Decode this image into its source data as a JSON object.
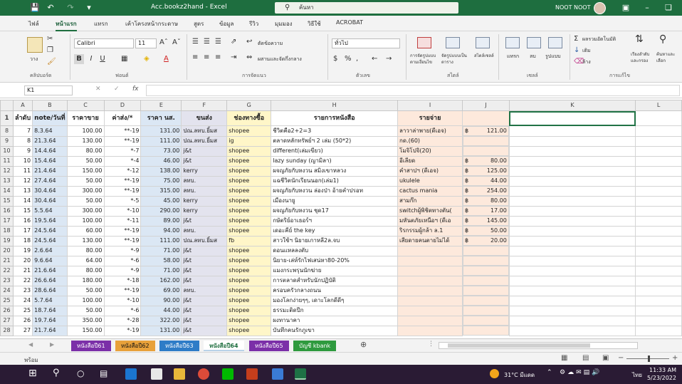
{
  "title_bar": {
    "filename": "Acc.bookz2hand - Excel",
    "search_placeholder": "ค้นหา",
    "user": "NOOT NOOT"
  },
  "ribbon_tabs": [
    "ไฟล์",
    "หน้าแรก",
    "แทรก",
    "เค้าโครงหน้ากระดาษ",
    "สูตร",
    "ข้อมูล",
    "รีวิว",
    "มุมมอง",
    "วิธีใช้",
    "ACROBAT"
  ],
  "ribbon": {
    "paste_label": "วาง",
    "font_name": "Calibri",
    "font_size": "11",
    "wrap_text": "ตัดข้อความ",
    "merge_center": "ผสานและจัดกึ่งกลาง",
    "number_format": "ทั่วไป",
    "cond_format": "การจัดรูปแบบตามเงื่อนไข",
    "format_table": "จัดรูปแบบเป็นตาราง",
    "cell_styles": "สไตล์เซลล์",
    "insert": "แทรก",
    "delete": "ลบ",
    "format": "รูปแบบ",
    "autosum": "ผลรวมอัตโนมัติ",
    "fill": "เติม",
    "clear": "ล้าง",
    "sort_filter": "เรียงลำดับและกรอง",
    "find_select": "ค้นหาและเลือก",
    "groups": [
      "คลิปบอร์ด",
      "ฟอนต์",
      "การจัดแนว",
      "ตัวเลข",
      "สไตล์",
      "เซลล์",
      "การแก้ไข"
    ]
  },
  "formula_bar": {
    "name_box": "K1",
    "fx": "fx",
    "content": ""
  },
  "columns": [
    "A",
    "B",
    "C",
    "D",
    "E",
    "F",
    "G",
    "H",
    "I",
    "J",
    "K",
    "L"
  ],
  "header_row": {
    "row": "1",
    "cells": [
      "ลำดับ",
      "note/วันที่",
      "ราคาขาย",
      "ค่าส่ง/*",
      "ราคา นส.",
      "ขนส่ง",
      "ช่องทางซื้อ",
      "รายการหนังสือ",
      "รายจ่าย",
      "",
      "",
      ""
    ]
  },
  "rows": [
    {
      "r": "8",
      "a": "7",
      "b": "8.3.64",
      "c": "100.00",
      "d": "**-19",
      "e": "131.00",
      "f": "ปณ.ลทบ.ยิ้มส",
      "g": "shopee",
      "h": "ชีวิตคือ2+2=3",
      "i": "ลาวาล่าพาย(ดีเอจ)",
      "cur": "฿",
      "j": "121.00"
    },
    {
      "r": "9",
      "a": "8",
      "b": "21.3.64",
      "c": "130.00",
      "d": "**-19",
      "e": "111.00",
      "f": "ปณ.ลทบ.ยิ้มส",
      "g": "ig",
      "h": "ตลาดหลักทรัพย์ฯ 2 เล่ม (50*2)",
      "i": "กด.(60)",
      "cur": "",
      "j": ""
    },
    {
      "r": "10",
      "a": "9",
      "b": "14.4.64",
      "c": "80.00",
      "d": "*-7",
      "e": "73.00",
      "f": "j&t",
      "g": "shopee",
      "h": "different(เล่มเขียว)",
      "i": "โมจิโปจิ(20)",
      "cur": "",
      "j": ""
    },
    {
      "r": "11",
      "a": "10",
      "b": "15.4.64",
      "c": "50.00",
      "d": "*-4",
      "e": "46.00",
      "f": "j&t",
      "g": "shopee",
      "h": "lazy sunday (ญามิลา)",
      "i": "อีเลียด",
      "cur": "฿",
      "j": "80.00"
    },
    {
      "r": "12",
      "a": "11",
      "b": "21.4.64",
      "c": "150.00",
      "d": "*-12",
      "e": "138.00",
      "f": "kerry",
      "g": "shopee",
      "h": "ผจญภัยกับหงวน สมิงเขาหลวง",
      "i": "คำสาปฯ (ดีเอจ)",
      "cur": "฿",
      "j": "125.00"
    },
    {
      "r": "13",
      "a": "12",
      "b": "27.4.64",
      "c": "50.00",
      "d": "**-19",
      "e": "75.00",
      "f": "ลทบ.",
      "g": "shopee",
      "h": "แฉชีวิตนักเรียนนอก(เล่ม1)",
      "i": "ukulele",
      "cur": "฿",
      "j": "44.00"
    },
    {
      "r": "14",
      "a": "13",
      "b": "30.4.64",
      "c": "300.00",
      "d": "**-19",
      "e": "315.00",
      "f": "ลทบ.",
      "g": "shopee",
      "h": "ผจญภัยกับหงวน ล่องป่า อ้ายคำปรอท",
      "i": "cactus mania",
      "cur": "฿",
      "j": "254.00"
    },
    {
      "r": "15",
      "a": "14",
      "b": "30.4.64",
      "c": "50.00",
      "d": "*-5",
      "e": "45.00",
      "f": "kerry",
      "g": "shopee",
      "h": "เมืองนายู",
      "i": "สามก๊ก",
      "cur": "฿",
      "j": "80.00"
    },
    {
      "r": "16",
      "a": "15",
      "b": "5.5.64",
      "c": "300.00",
      "d": "*-10",
      "e": "290.00",
      "f": "kerry",
      "g": "shopee",
      "h": "ผจญภัยกับหงวน ชุด17",
      "i": "switchผู้พิชิตทางตัน(",
      "cur": "฿",
      "j": "17.00"
    },
    {
      "r": "17",
      "a": "16",
      "b": "19.5.64",
      "c": "100.00",
      "d": "*-11",
      "e": "89.00",
      "f": "j&t",
      "g": "shopee",
      "h": "กษัตริย์อาเธอร์ฯ",
      "i": "มหันตภัยเหนือฯ (ดีเอ",
      "cur": "฿",
      "j": "145.00"
    },
    {
      "r": "18",
      "a": "17",
      "b": "24.5.64",
      "c": "60.00",
      "d": "**-19",
      "e": "94.00",
      "f": "ลทบ.",
      "g": "shopee",
      "h": "เดอะคีย์ the key",
      "i": "ริรกรรมผู้กล้า ล.1",
      "cur": "฿",
      "j": "50.00"
    },
    {
      "r": "19",
      "a": "18",
      "b": "24.5.64",
      "c": "130.00",
      "d": "**-19",
      "e": "111.00",
      "f": "ปณ.ลทบ.ยิ้มส",
      "g": "fb",
      "h": "สาวใช้ฯ นิยายเกาหลี2ล.จบ",
      "i": "เสียดายคนตายไม่ได้",
      "cur": "฿",
      "j": "20.00"
    },
    {
      "r": "20",
      "a": "19",
      "b": "2.6.64",
      "c": "80.00",
      "d": "*-9",
      "e": "71.00",
      "f": "j&t",
      "g": "shopee",
      "h": "ดอนแหลลงตับ",
      "i": "",
      "cur": "",
      "j": ""
    },
    {
      "r": "21",
      "a": "20",
      "b": "9.6.64",
      "c": "64.00",
      "d": "*-6",
      "e": "58.00",
      "f": "j&t",
      "g": "shopee",
      "h": "นิยาย-เล่ห์รักไฟเสน่หา80-20%",
      "i": "",
      "cur": "",
      "j": ""
    },
    {
      "r": "22",
      "a": "21",
      "b": "21.6.64",
      "c": "80.00",
      "d": "*-9",
      "e": "71.00",
      "f": "j&t",
      "g": "shopee",
      "h": "แมงกระพรุนนักฆ่าย",
      "i": "",
      "cur": "",
      "j": ""
    },
    {
      "r": "23",
      "a": "22",
      "b": "26.6.64",
      "c": "180.00",
      "d": "*-18",
      "e": "162.00",
      "f": "j&t",
      "g": "shopee",
      "h": "การตลาดสำหรับนักปฏิบัติ",
      "i": "",
      "cur": "",
      "j": ""
    },
    {
      "r": "24",
      "a": "23",
      "b": "28.6.64",
      "c": "50.00",
      "d": "**-19",
      "e": "69.00",
      "f": "ลทบ.",
      "g": "shopee",
      "h": "ครอบครัวกลางถนน",
      "i": "",
      "cur": "",
      "j": ""
    },
    {
      "r": "25",
      "a": "24",
      "b": "5.7.64",
      "c": "100.00",
      "d": "*-10",
      "e": "90.00",
      "f": "j&t",
      "g": "shopee",
      "h": "มองโลกง่ายๆๆ, เดาะโลกดีดีๆ",
      "i": "",
      "cur": "",
      "j": ""
    },
    {
      "r": "26",
      "a": "25",
      "b": "18.7.64",
      "c": "50.00",
      "d": "*-6",
      "e": "44.00",
      "f": "j&t",
      "g": "shopee",
      "h": "ธรรมะติดปีก",
      "i": "",
      "cur": "",
      "j": ""
    },
    {
      "r": "27",
      "a": "26",
      "b": "19.7.64",
      "c": "350.00",
      "d": "*-28",
      "e": "322.00",
      "f": "j&t",
      "g": "shopee",
      "h": "ผงทานาคา",
      "i": "",
      "cur": "",
      "j": ""
    },
    {
      "r": "28",
      "a": "27",
      "b": "21.7.64",
      "c": "150.00",
      "d": "*-19",
      "e": "131.00",
      "f": "j&t",
      "g": "shopee",
      "h": "บันทึกคนรักภูเขา",
      "i": "",
      "cur": "",
      "j": ""
    }
  ],
  "sheet_tabs": [
    {
      "label": "หนังสือปี61",
      "color": "#7b2fa8",
      "active": false
    },
    {
      "label": "หนังสือปี62",
      "color": "#e8a13a",
      "active": false
    },
    {
      "label": "หนังสือปี63",
      "color": "#2e7cc7",
      "active": false
    },
    {
      "label": "หนังสือปี64",
      "color": "#b9d2e8",
      "active": true
    },
    {
      "label": "หนังสือปี65",
      "color": "#7b2fa8",
      "active": false
    },
    {
      "label": "บัญชี kbank",
      "color": "#2e9a3e",
      "active": false
    }
  ],
  "status": {
    "mode": "พร้อม"
  },
  "taskbar": {
    "weather": "31°C มีแดด",
    "lang": "ไทย",
    "time": "11:33 AM",
    "date": "5/23/2022"
  }
}
